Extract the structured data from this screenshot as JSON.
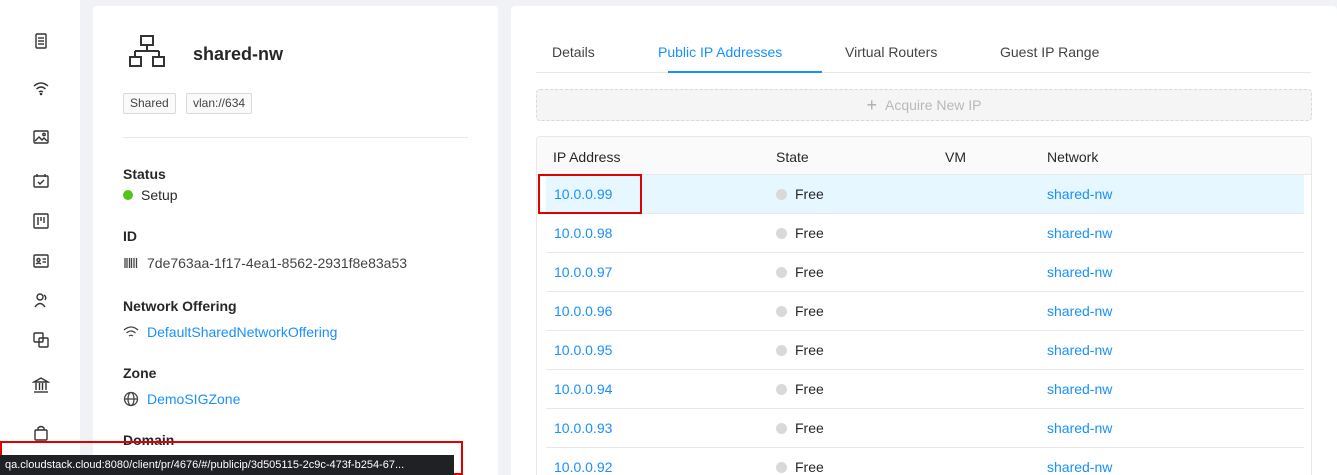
{
  "rail": {
    "icons": [
      "server-icon",
      "wifi-icon",
      "image-icon",
      "calendar-icon",
      "board-icon",
      "id-card-icon",
      "users-icon",
      "copy-icon",
      "bank-icon",
      "shopping-bag-icon"
    ]
  },
  "resource": {
    "icon": "cluster-icon",
    "name": "shared-nw",
    "tags": [
      "Shared",
      "vlan://634"
    ],
    "fields": {
      "status": {
        "label": "Status",
        "value": "Setup",
        "color": "#52c41a"
      },
      "id": {
        "label": "ID",
        "value": "7de763aa-1f17-4ea1-8562-2931f8e83a53",
        "icon": "barcode-icon"
      },
      "network_offering": {
        "label": "Network Offering",
        "value": "DefaultSharedNetworkOffering",
        "icon": "wifi-icon"
      },
      "zone": {
        "label": "Zone",
        "value": "DemoSIGZone",
        "icon": "globe-icon"
      },
      "domain": {
        "label": "Domain"
      }
    }
  },
  "tabs": [
    {
      "label": "Details",
      "active": false
    },
    {
      "label": "Public IP Addresses",
      "active": true
    },
    {
      "label": "Virtual Routers",
      "active": false
    },
    {
      "label": "Guest IP Range",
      "active": false
    }
  ],
  "acquire": {
    "label": "Acquire New IP",
    "icon": "plus-icon",
    "disabled": true
  },
  "table": {
    "headers": [
      "IP Address",
      "State",
      "VM",
      "Network"
    ],
    "rows": [
      {
        "ip": "10.0.0.99",
        "state": "Free",
        "vm": "",
        "network": "shared-nw",
        "highlighted": true
      },
      {
        "ip": "10.0.0.98",
        "state": "Free",
        "vm": "",
        "network": "shared-nw",
        "highlighted": false
      },
      {
        "ip": "10.0.0.97",
        "state": "Free",
        "vm": "",
        "network": "shared-nw",
        "highlighted": false
      },
      {
        "ip": "10.0.0.96",
        "state": "Free",
        "vm": "",
        "network": "shared-nw",
        "highlighted": false
      },
      {
        "ip": "10.0.0.95",
        "state": "Free",
        "vm": "",
        "network": "shared-nw",
        "highlighted": false
      },
      {
        "ip": "10.0.0.94",
        "state": "Free",
        "vm": "",
        "network": "shared-nw",
        "highlighted": false
      },
      {
        "ip": "10.0.0.93",
        "state": "Free",
        "vm": "",
        "network": "shared-nw",
        "highlighted": false
      },
      {
        "ip": "10.0.0.92",
        "state": "Free",
        "vm": "",
        "network": "shared-nw",
        "highlighted": false
      }
    ]
  },
  "statusbar": {
    "url": "qa.cloudstack.cloud:8080/client/pr/4676/#/publicip/3d505115-2c9c-473f-b254-67..."
  },
  "colors": {
    "link": "#1890ff",
    "highlight": "#e6f7ff",
    "annotation": "#e00000"
  }
}
